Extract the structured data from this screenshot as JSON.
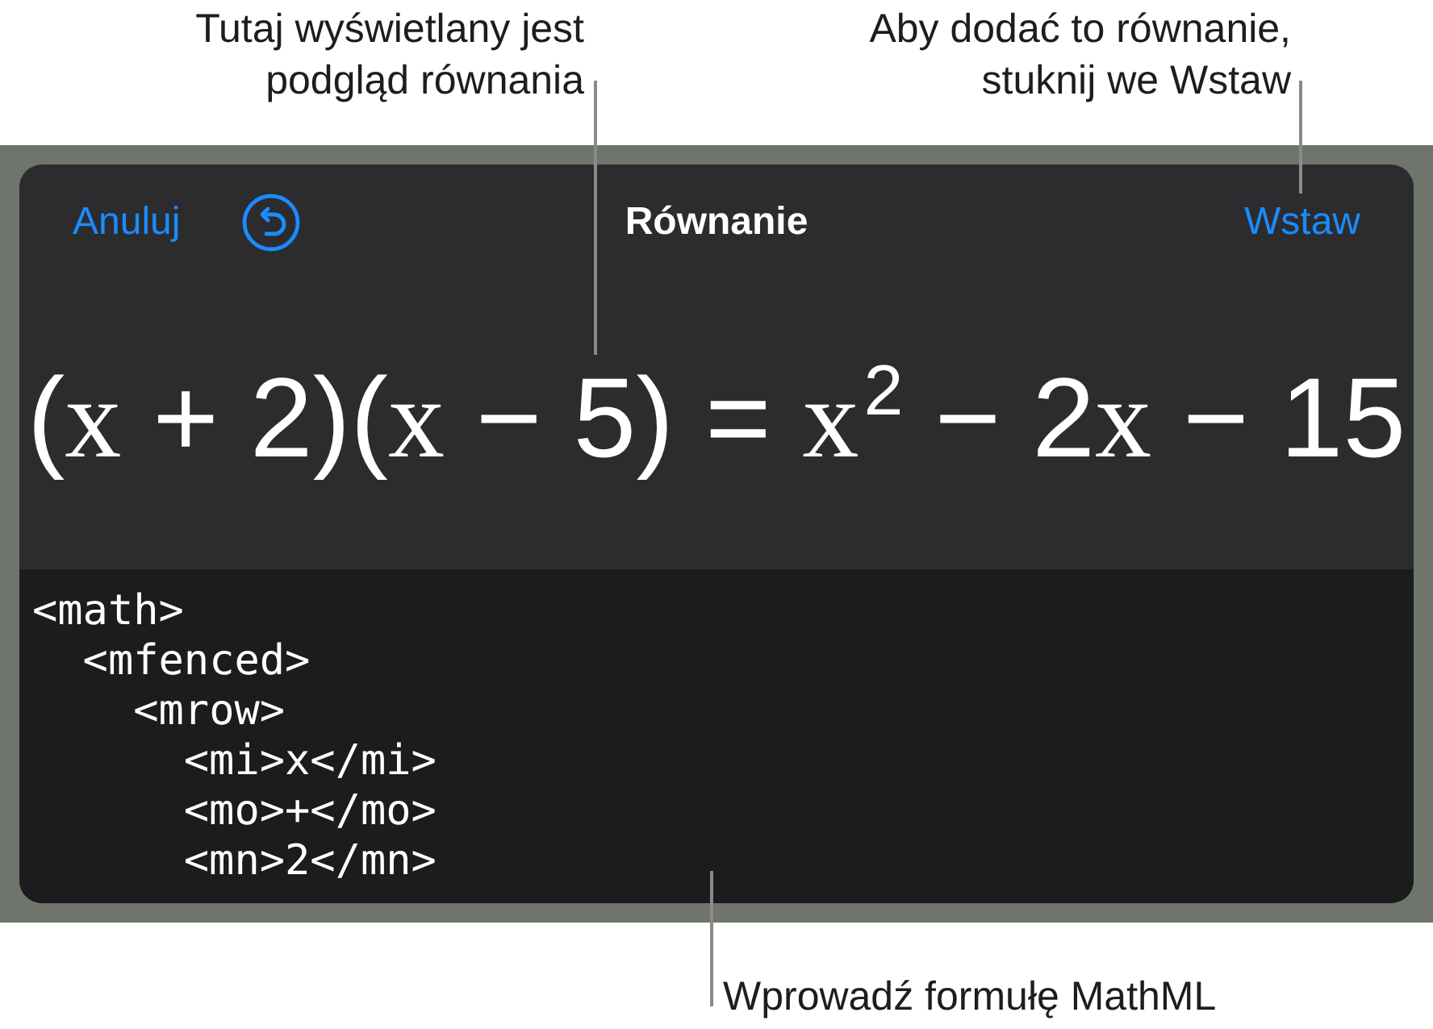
{
  "callouts": {
    "preview_note": {
      "lines": [
        "Tutaj wyświetlany jest",
        "podgląd równania"
      ]
    },
    "insert_note": {
      "lines": [
        "Aby dodać to równanie,",
        "stuknij we Wstaw"
      ]
    },
    "input_note": {
      "lines": [
        "Wprowadź formułę MathML"
      ]
    }
  },
  "dialog": {
    "cancel_button": "Anuluj",
    "title": "Równanie",
    "insert_button": "Wstaw"
  },
  "preview": {
    "tokens": [
      {
        "kind": "mo",
        "text": "("
      },
      {
        "kind": "mi",
        "text": "x"
      },
      {
        "kind": "mo",
        "text": " + "
      },
      {
        "kind": "mn",
        "text": "2"
      },
      {
        "kind": "mo",
        "text": ")"
      },
      {
        "kind": "mo",
        "text": "("
      },
      {
        "kind": "mi",
        "text": "x"
      },
      {
        "kind": "mo",
        "text": " − "
      },
      {
        "kind": "mn",
        "text": "5"
      },
      {
        "kind": "mo",
        "text": ")"
      },
      {
        "kind": "mo",
        "text": " = "
      },
      {
        "kind": "mi",
        "text": "x"
      },
      {
        "kind": "sup",
        "text": "2"
      },
      {
        "kind": "mo",
        "text": " − "
      },
      {
        "kind": "mn",
        "text": "2"
      },
      {
        "kind": "mi",
        "text": "x"
      },
      {
        "kind": "mo",
        "text": " − "
      },
      {
        "kind": "mn",
        "text": "15"
      }
    ]
  },
  "mathml_input": {
    "lines": [
      {
        "text": "<math>",
        "children": [
          {
            "text": "<mfenced>",
            "children": [
              {
                "text": "<mrow>",
                "children": [
                  {
                    "text": "<mi>x</mi>"
                  },
                  {
                    "text": "<mo>+</mo>"
                  },
                  {
                    "text": "<mn>2</mn>"
                  }
                ]
              }
            ]
          }
        ]
      }
    ]
  }
}
